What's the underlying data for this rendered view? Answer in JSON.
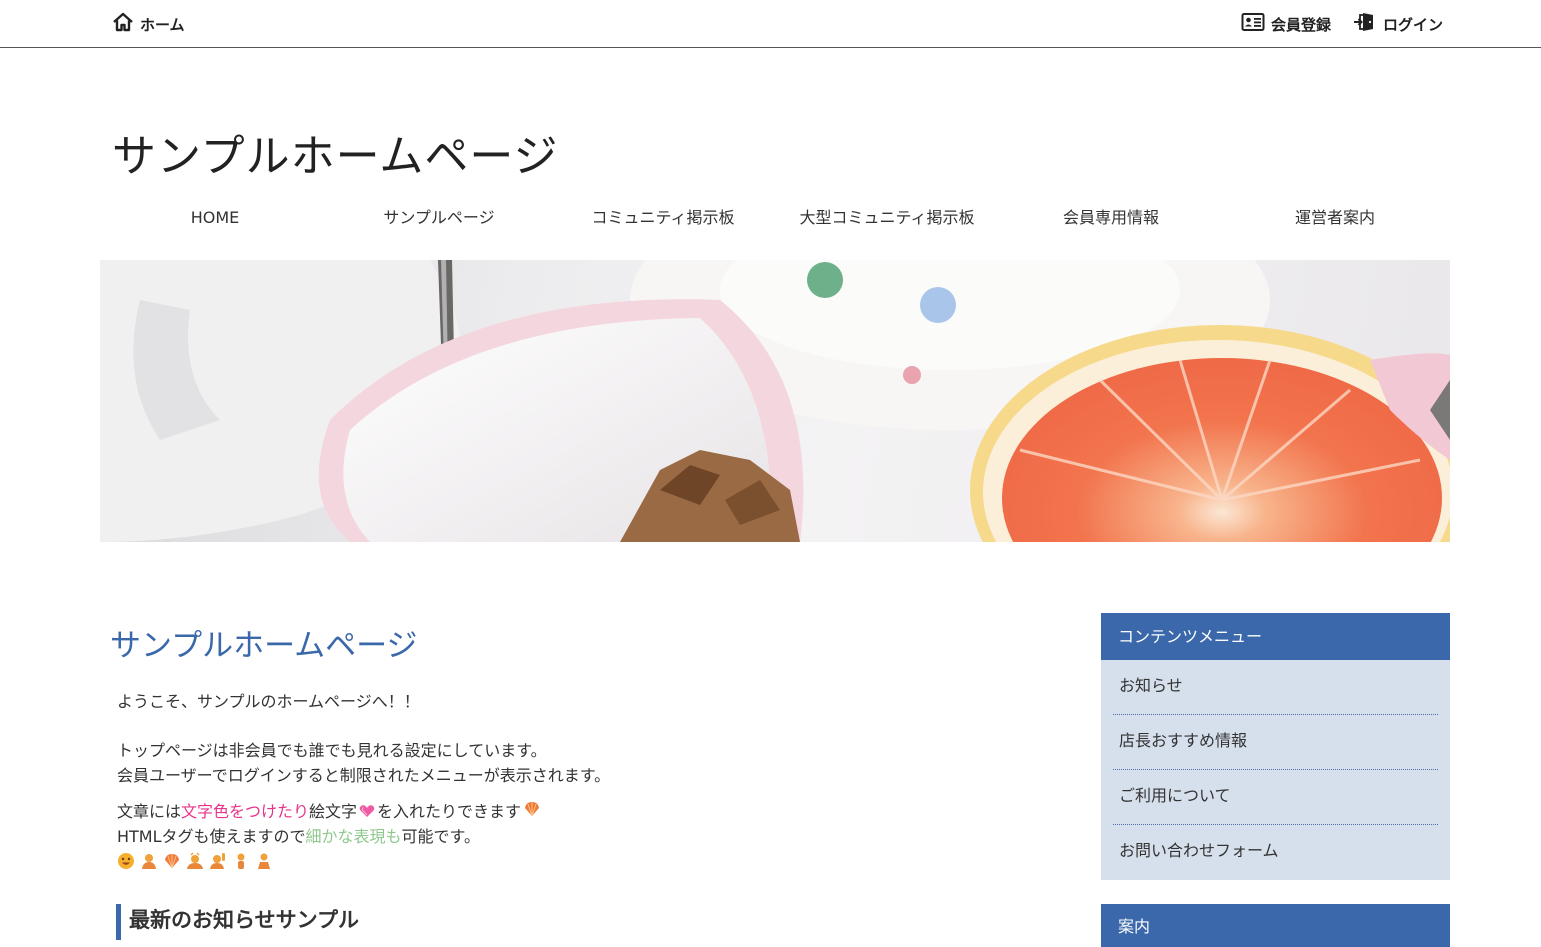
{
  "topbar": {
    "home_label": "ホーム",
    "register_label": "会員登録",
    "login_label": "ログイン"
  },
  "site": {
    "title": "サンプルホームページ"
  },
  "nav": {
    "items": [
      "HOME",
      "サンプルページ",
      "コミュニティ掲示板",
      "大型コミュニティ掲示板",
      "会員専用情報",
      "運営者案内"
    ]
  },
  "main": {
    "heading": "サンプルホームページ",
    "welcome": "ようこそ、サンプルのホームページへ！！",
    "line2": "トップページは非会員でも誰でも見れる設定にしています。",
    "line3": "会員ユーザーでログインすると制限されたメニューが表示されます。",
    "line4_a": "文章には",
    "line4_pink": "文字色をつけたり",
    "line4_b": "絵文字",
    "line4_c": "を入れたりできます",
    "line5_a": "HTMLタグも使えますので",
    "line5_green": "細かな表現も",
    "line5_b": "可能です。",
    "subheading": "最新のお知らせサンプル"
  },
  "sidebar": {
    "menu_title": "コンテンツメニュー",
    "items": [
      "お知らせ",
      "店長おすすめ情報",
      "ご利用について",
      "お問い合わせフォーム"
    ],
    "info_title": "案内"
  },
  "colors": {
    "accent": "#3a68aa",
    "sidebar_bg": "#d6e0ec",
    "pink_text": "#e8338a",
    "green_text": "#8fc88f"
  }
}
